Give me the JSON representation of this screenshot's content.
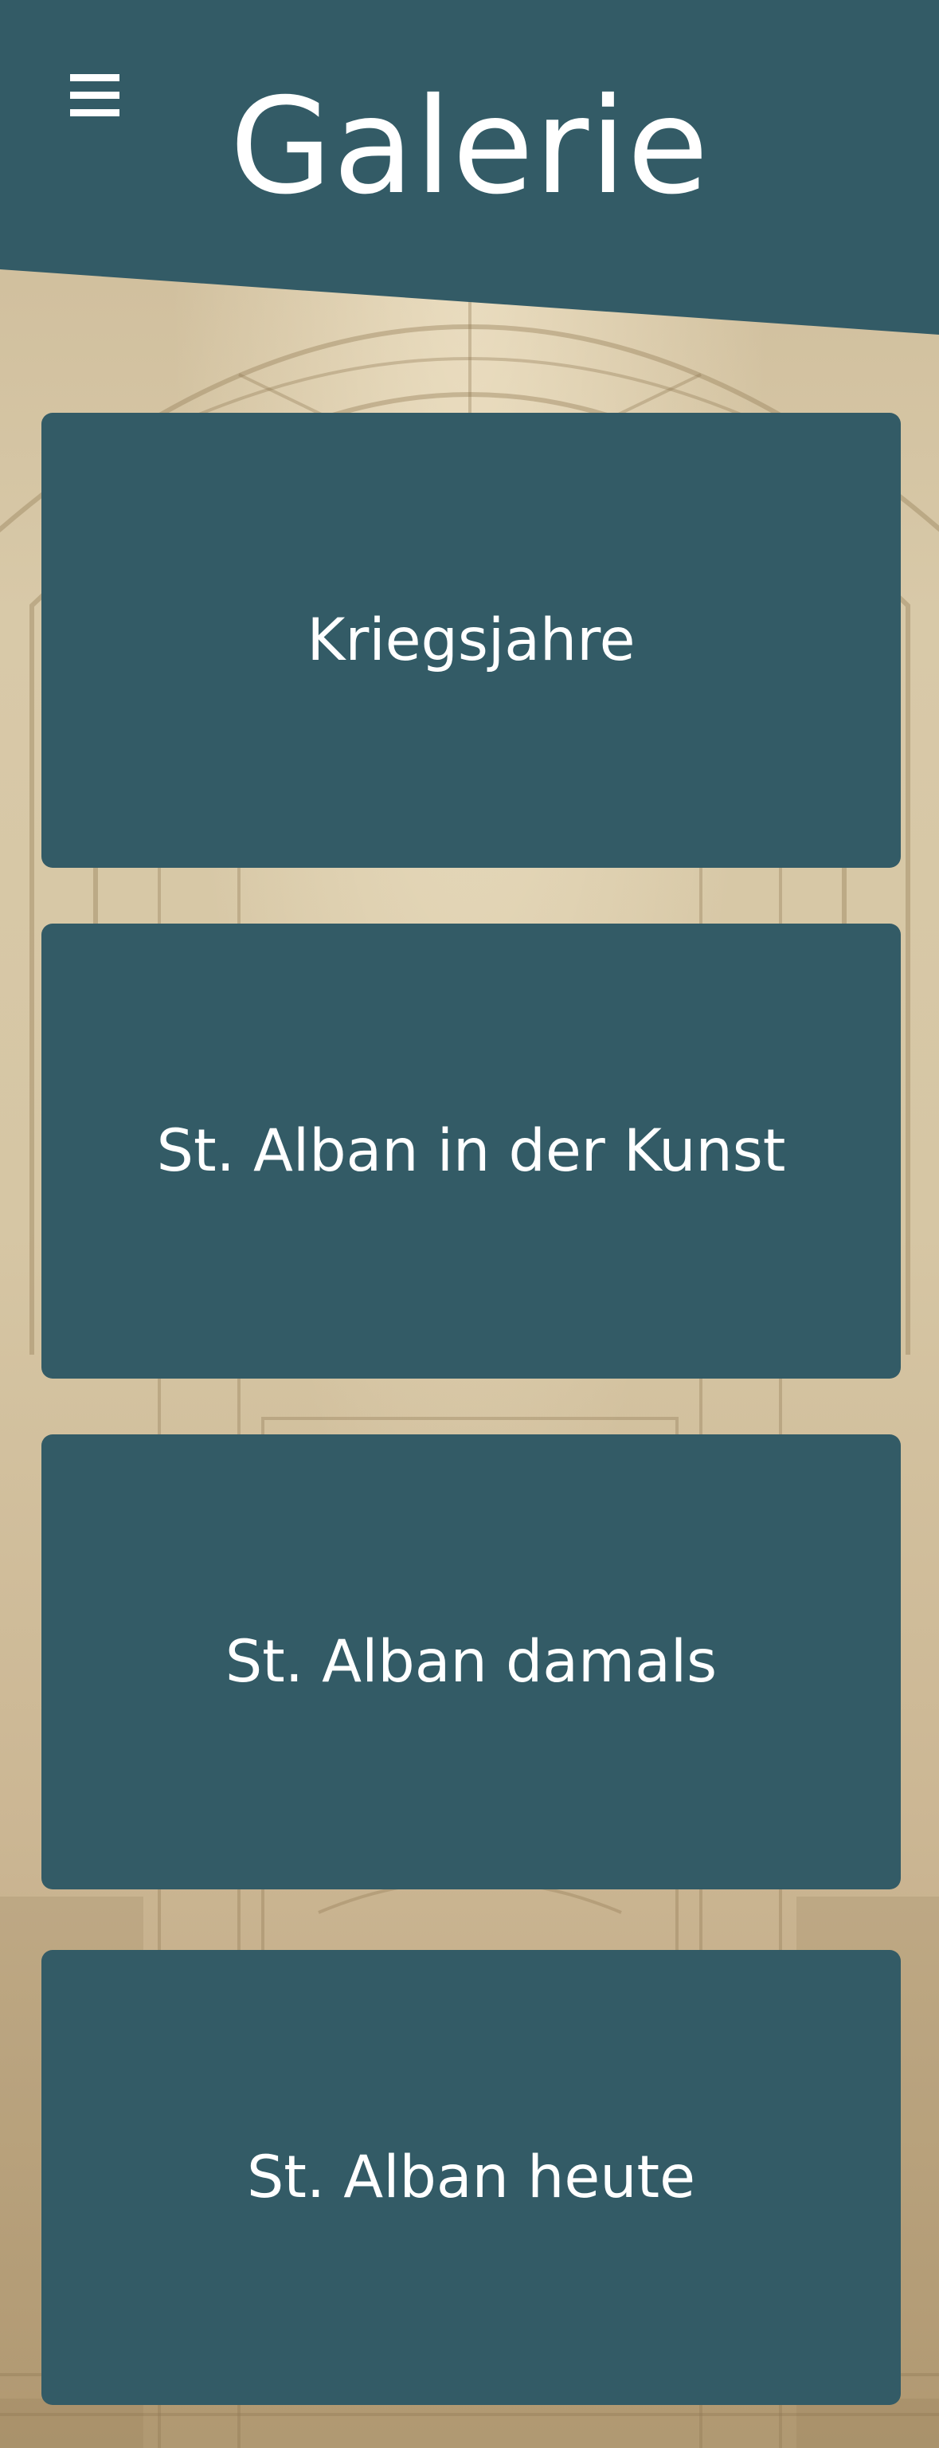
{
  "header": {
    "title": "Galerie",
    "menu_icon": "hamburger-menu-icon"
  },
  "gallery": {
    "items": [
      {
        "label": "Kriegsjahre"
      },
      {
        "label": "St. Alban in der Kunst"
      },
      {
        "label": "St. Alban damals"
      },
      {
        "label": "St. Alban heute"
      }
    ]
  },
  "colors": {
    "accent": "#335b66",
    "text": "#ffffff",
    "background": "#cbb896"
  }
}
